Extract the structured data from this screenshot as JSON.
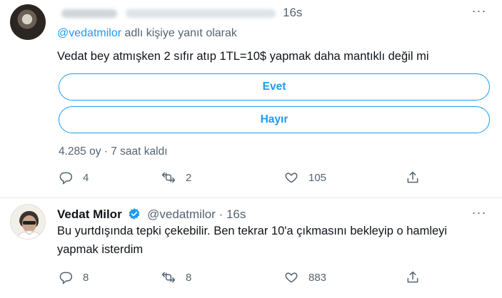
{
  "tweet1": {
    "time": "16s",
    "reply_prefix": "@vedatmilor",
    "reply_suffix": " adlı kişiye yanıt olarak",
    "text": "Vedat bey atmışken 2 sıfır atıp 1TL=10$ yapmak daha mantıklı değil mi",
    "poll": {
      "options": [
        "Evet",
        "Hayır"
      ],
      "votes": "4.285 oy",
      "separator": " · ",
      "remaining": "7 saat kaldı"
    },
    "actions": {
      "reply_count": "4",
      "retweet_count": "2",
      "like_count": "105"
    },
    "more_icon": "more-horizontal-icon"
  },
  "tweet2": {
    "name": "Vedat Milor",
    "handle": "@vedatmilor",
    "separator": " · ",
    "time": "16s",
    "text_line1": "Bu yurtdışında tepki çekebilir. Ben tekrar 10'a çıkmasını bekleyip o hamleyi",
    "text_line2": "yapmak isterdim",
    "actions": {
      "reply_count": "8",
      "retweet_count": "8",
      "like_count": "883"
    },
    "verified_color": "#1d9bf0"
  },
  "colors": {
    "accent": "#1d9bf0",
    "muted": "#536471",
    "text": "#0f1419",
    "divider": "#e6ecf0"
  }
}
